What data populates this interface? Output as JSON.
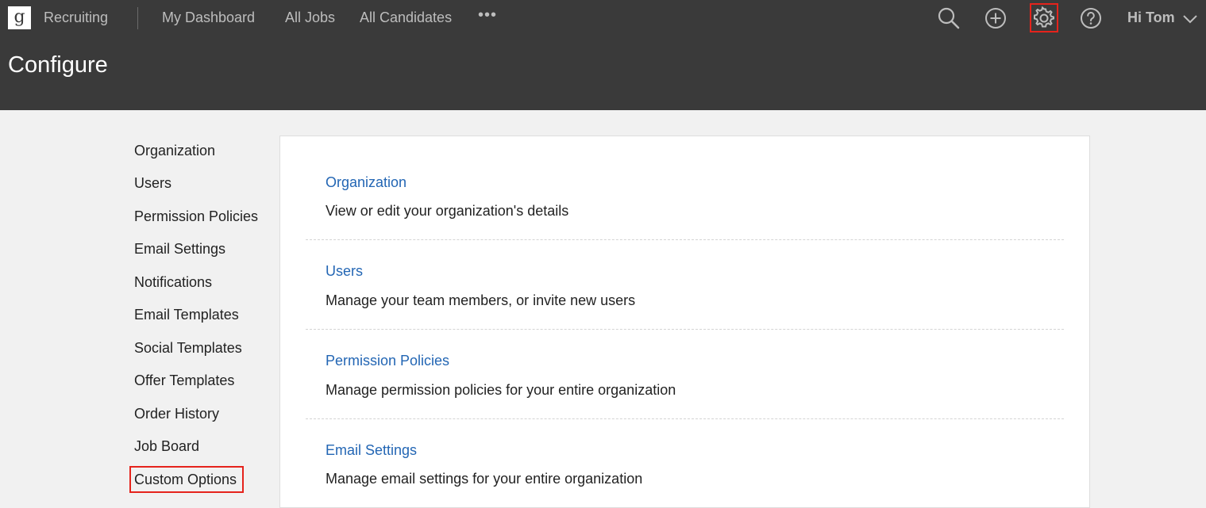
{
  "header": {
    "logo_letter": "g",
    "app_name": "Recruiting",
    "nav": [
      {
        "label": "My Dashboard"
      },
      {
        "label": "All Jobs"
      },
      {
        "label": "All Candidates"
      }
    ],
    "more_label": "•••",
    "icons": [
      "search-icon",
      "add-circle-icon",
      "gear-icon",
      "help-icon"
    ],
    "greeting": "Hi Tom",
    "page_title": "Configure"
  },
  "sidebar": {
    "items": [
      {
        "label": "Organization"
      },
      {
        "label": "Users"
      },
      {
        "label": "Permission Policies"
      },
      {
        "label": "Email Settings"
      },
      {
        "label": "Notifications"
      },
      {
        "label": "Email Templates"
      },
      {
        "label": "Social Templates"
      },
      {
        "label": "Offer Templates"
      },
      {
        "label": "Order History"
      },
      {
        "label": "Job Board"
      },
      {
        "label": "Custom Options"
      }
    ]
  },
  "main": {
    "sections": [
      {
        "title": "Organization",
        "description": "View or edit your organization's details"
      },
      {
        "title": "Users",
        "description": "Manage your team members, or invite new users"
      },
      {
        "title": "Permission Policies",
        "description": "Manage permission policies for your entire organization"
      },
      {
        "title": "Email Settings",
        "description": "Manage email settings for your entire organization"
      }
    ]
  },
  "colors": {
    "header_bg": "#3a3a3a",
    "link": "#2366b4",
    "highlight": "#e5231c"
  }
}
